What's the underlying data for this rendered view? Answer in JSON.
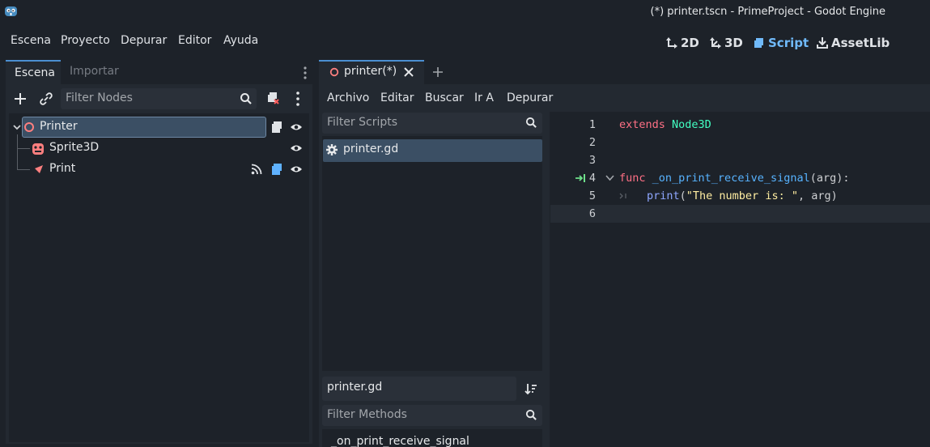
{
  "window": {
    "title": "(*) printer.tscn - PrimeProject - Godot Engine"
  },
  "menu": [
    "Escena",
    "Proyecto",
    "Depurar",
    "Editor",
    "Ayuda"
  ],
  "workspaces": [
    {
      "label": "2D",
      "icon": "2d-icon",
      "active": false
    },
    {
      "label": "3D",
      "icon": "3d-icon",
      "active": false
    },
    {
      "label": "Script",
      "icon": "script-icon",
      "active": true
    },
    {
      "label": "AssetLib",
      "icon": "assetlib-icon",
      "active": false
    }
  ],
  "left_dock": {
    "tabs": [
      "Escena",
      "Importar"
    ],
    "filter_placeholder": "Filter Nodes",
    "tree": [
      {
        "label": "Printer",
        "icon": "node3d-icon",
        "selected": true
      },
      {
        "label": "Sprite3D",
        "icon": "sprite3d-icon",
        "selected": false
      },
      {
        "label": "Print",
        "icon": "custom-node-icon",
        "selected": false
      }
    ]
  },
  "script_editor": {
    "tab_label": "printer(*)",
    "menu": [
      "Archivo",
      "Editar",
      "Buscar",
      "Ir A",
      "Depurar"
    ],
    "filter_scripts_placeholder": "Filter Scripts",
    "scripts": [
      "printer.gd"
    ],
    "current_script": "printer.gd",
    "filter_methods_placeholder": "Filter Methods",
    "methods": [
      "_on_print_receive_signal"
    ],
    "code": {
      "l1_kw": "extends",
      "l1_type": "Node3D",
      "l4_kw": "func",
      "l4_fn": "_on_print_receive_signal",
      "l4_rest": "(arg):",
      "l5_builtin": "print",
      "l5_open": "(",
      "l5_str": "\"The number is: \"",
      "l5_rest": ", arg)",
      "line_numbers": [
        "1",
        "2",
        "3",
        "4",
        "5",
        "6"
      ]
    }
  },
  "colors": {
    "accent": "#70bafa",
    "keyword": "#ff7085",
    "type": "#42ffc2",
    "string": "#ffeda1"
  }
}
